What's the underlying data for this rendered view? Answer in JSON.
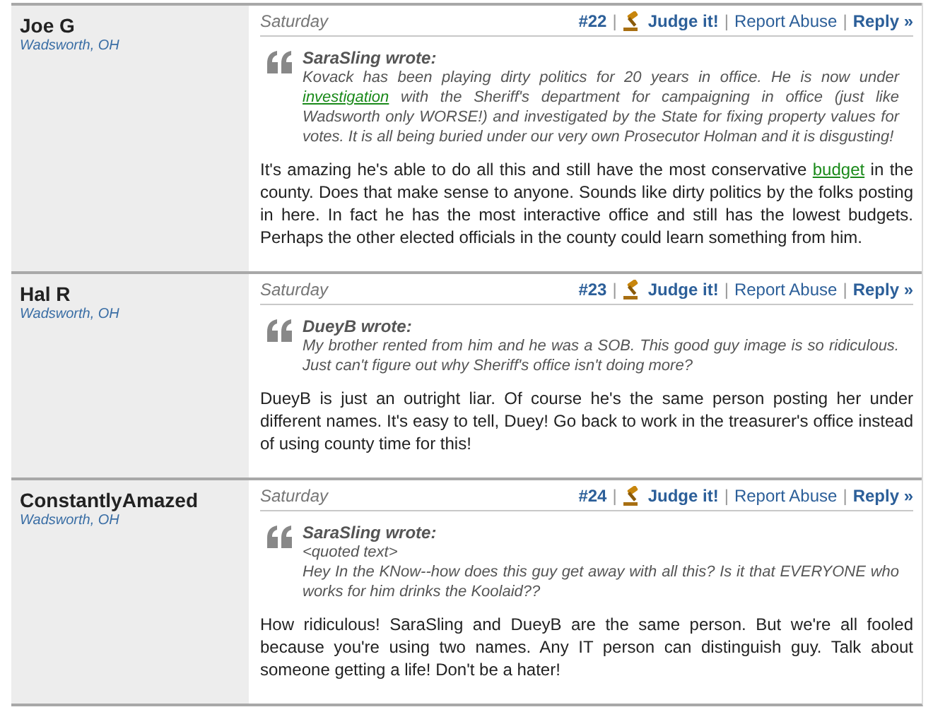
{
  "posts": [
    {
      "author": "Joe G",
      "location": "Wadsworth, OH",
      "date": "Saturday",
      "actions": [
        {
          "kind": "number",
          "text": "#22"
        },
        {
          "kind": "sep",
          "text": "|"
        },
        {
          "kind": "judge",
          "text": "Judge it!"
        },
        {
          "kind": "sep",
          "text": "|"
        },
        {
          "kind": "report",
          "text": "Report Abuse"
        },
        {
          "kind": "sep",
          "text": "|"
        },
        {
          "kind": "reply",
          "text": "Reply »"
        }
      ],
      "quote": {
        "author": "SaraSling wrote:",
        "paragraphs": [
          [
            {
              "kind": "text",
              "text": "Kovack has been playing dirty politics for 20 years in office. He is now under "
            },
            {
              "kind": "link",
              "text": "investigation"
            },
            {
              "kind": "text",
              "text": " with the Sheriff's department for campaigning in office (just like Wadsworth only WORSE!) and investigated by the State for fixing property values for votes. It is all being buried under our very own Prosecutor Holman and it is disgusting!"
            }
          ]
        ]
      },
      "body": [
        {
          "kind": "text",
          "text": "It's amazing he's able to do all this and still have the most conservative "
        },
        {
          "kind": "link",
          "text": "budget"
        },
        {
          "kind": "text",
          "text": " in the county. Does that make sense to anyone. Sounds like dirty politics by the folks posting in here. In fact he has the most interactive office and still has the lowest budgets. Perhaps the other elected officials in the county could learn something from him."
        }
      ]
    },
    {
      "author": "Hal R",
      "location": "Wadsworth, OH",
      "date": "Saturday",
      "actions": [
        {
          "kind": "number",
          "text": "#23"
        },
        {
          "kind": "sep",
          "text": "|"
        },
        {
          "kind": "judge",
          "text": "Judge it!"
        },
        {
          "kind": "sep",
          "text": "|"
        },
        {
          "kind": "report",
          "text": "Report Abuse"
        },
        {
          "kind": "sep",
          "text": "|"
        },
        {
          "kind": "reply",
          "text": "Reply »"
        }
      ],
      "quote": {
        "author": "DueyB wrote:",
        "paragraphs": [
          [
            {
              "kind": "text",
              "text": "My brother rented from him and he was a SOB. This good guy image is so ridiculous. Just can't figure out why Sheriff's office isn't doing more?"
            }
          ]
        ]
      },
      "body": [
        {
          "kind": "text",
          "text": "DueyB is just an outright liar. Of course he's the same person posting her under different names. It's easy to tell, Duey! Go back to work in the treasurer's office instead of using county time for this!"
        }
      ]
    },
    {
      "author": "ConstantlyAmazed",
      "location": "Wadsworth, OH",
      "date": "Saturday",
      "actions": [
        {
          "kind": "number",
          "text": "#24"
        },
        {
          "kind": "sep",
          "text": "|"
        },
        {
          "kind": "judge",
          "text": "Judge it!"
        },
        {
          "kind": "sep",
          "text": "|"
        },
        {
          "kind": "report",
          "text": "Report Abuse"
        },
        {
          "kind": "sep",
          "text": "|"
        },
        {
          "kind": "reply",
          "text": "Reply »"
        }
      ],
      "quote": {
        "author": "SaraSling wrote:",
        "paragraphs": [
          [
            {
              "kind": "text",
              "text": "<quoted text>"
            }
          ],
          [
            {
              "kind": "text",
              "text": "Hey In the KNow--how does this guy get away with all this? Is it that EVERYONE who works for him drinks the Koolaid??"
            }
          ]
        ]
      },
      "body": [
        {
          "kind": "text",
          "text": "How ridiculous! SaraSling and DueyB are the same person. But we're all fooled because you're using two names. Any IT person can distinguish guy. Talk about someone getting a life! Don't be a hater!"
        }
      ]
    }
  ]
}
